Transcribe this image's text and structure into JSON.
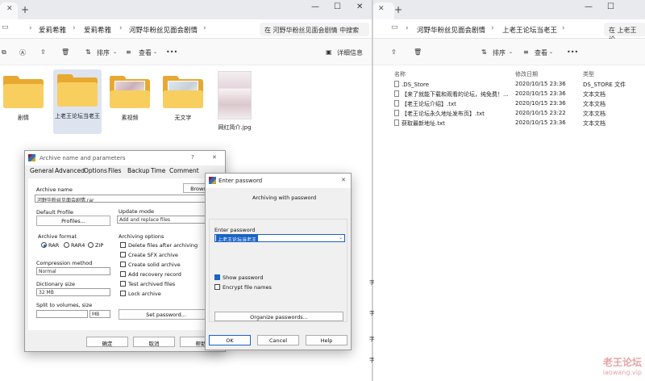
{
  "left_explorer": {
    "tab_close": "✕",
    "tab_new": "+",
    "win_min": "—",
    "win_max": "☐",
    "win_close": "✕",
    "breadcrumb": [
      "爱莉希雅",
      "爱莉希雅",
      "河野华粉丝见面会剧情"
    ],
    "search_placeholder": "在 河野华粉丝见面会剧情 中搜索",
    "toolbar": {
      "sort": "排序",
      "view": "查看",
      "more": "•••",
      "details": "详细信息"
    },
    "items": [
      {
        "name": "剧情"
      },
      {
        "name": "上老王论坛当老王"
      },
      {
        "name": "素视频"
      },
      {
        "name": "无文字"
      },
      {
        "name": "网红简介.jpg"
      }
    ]
  },
  "right_explorer": {
    "tab_close": "✕",
    "tab_new": "+",
    "win_min": "—",
    "win_max": "☐",
    "breadcrumb": [
      "河野华粉丝见面会剧情",
      "上老王论坛当老王"
    ],
    "search_placeholder": "在 上老王论",
    "toolbar": {
      "sort": "排序",
      "view": "查看",
      "more": "•••"
    },
    "columns": {
      "name": "名称",
      "modified": "修改日期",
      "type": "类型"
    },
    "rows": [
      {
        "name": ".DS_Store",
        "modified": "2020/10/15 23:36",
        "type": "DS_STORE 文件"
      },
      {
        "name": "【来了就能下载和观看的论坛，纯免费！...",
        "modified": "2020/10/15 23:36",
        "type": "文本文档"
      },
      {
        "name": "【老王论坛介绍】.txt",
        "modified": "2020/10/15 23:36",
        "type": "文本文档"
      },
      {
        "name": "【老王论坛永久地址发布页】.txt",
        "modified": "2020/10/15 23:22",
        "type": "文本文档"
      },
      {
        "name": "获取最新地址.txt",
        "modified": "2020/10/15 23:36",
        "type": "文本文档"
      }
    ],
    "side_chars": [
      "字",
      "字",
      "字",
      "字"
    ]
  },
  "archive_dialog": {
    "title": "Archive name and parameters",
    "help_glyph": "?",
    "close_glyph": "✕",
    "tabs": [
      "General",
      "Advanced",
      "Options",
      "Files",
      "Backup",
      "Time",
      "Comment"
    ],
    "archive_name_label": "Archive name",
    "browse_label": "Browse...",
    "archive_name_value": "河野华粉丝见面会剧情.rar",
    "default_profile_label": "Default Profile",
    "profiles_button": "Profiles...",
    "update_mode_label": "Update mode",
    "update_mode_value": "Add and replace files",
    "archive_format_label": "Archive format",
    "formats": [
      "RAR",
      "RAR4",
      "ZIP"
    ],
    "selected_format": "RAR",
    "archiving_options_label": "Archiving options",
    "options": [
      {
        "label": "Delete files after archiving",
        "checked": false
      },
      {
        "label": "Create SFX archive",
        "checked": false
      },
      {
        "label": "Create solid archive",
        "checked": false
      },
      {
        "label": "Add recovery record",
        "checked": false
      },
      {
        "label": "Test archived files",
        "checked": false
      },
      {
        "label": "Lock archive",
        "checked": false
      }
    ],
    "compression_label": "Compression method",
    "compression_value": "Normal",
    "dictionary_label": "Dictionary size",
    "dictionary_value": "32 MB",
    "split_label": "Split to volumes, size",
    "split_unit": "MB",
    "set_password_button": "Set password...",
    "ok_button": "确定",
    "cancel_button": "取消",
    "help_button": "帮助"
  },
  "password_dialog": {
    "title": "Enter password",
    "close_glyph": "✕",
    "subtitle": "Archiving with password",
    "enter_password_label": "Enter password",
    "password_value": "上老王论坛当老王",
    "show_password_label": "Show password",
    "show_password_checked": true,
    "encrypt_names_label": "Encrypt file names",
    "encrypt_names_checked": false,
    "organize_button": "Organize passwords...",
    "ok_button": "OK",
    "cancel_button": "Cancel",
    "help_button": "Help"
  },
  "watermark": {
    "line1": "老王论坛",
    "line2": "laowang.vip"
  }
}
